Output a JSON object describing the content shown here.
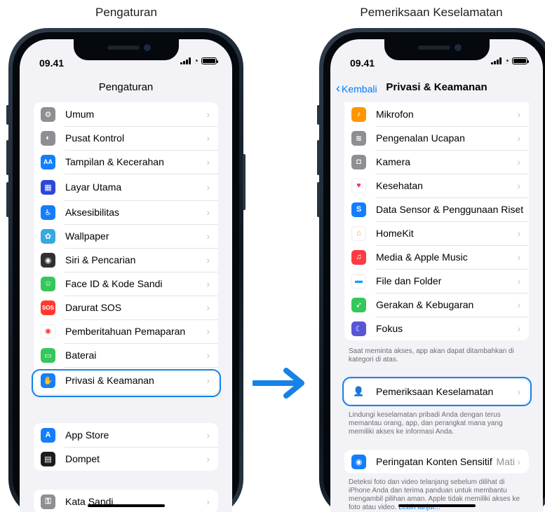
{
  "captions": {
    "left": "Pengaturan",
    "right": "Pemeriksaan Keselamatan"
  },
  "left_phone": {
    "time": "09.41",
    "nav_title": "Pengaturan",
    "group1": [
      {
        "label": "Umum",
        "icon": "gear-icon",
        "color": "#8e8e93"
      },
      {
        "label": "Pusat Kontrol",
        "icon": "toggle-icon",
        "color": "#8e8e93"
      },
      {
        "label": "Tampilan & Kecerahan",
        "icon": "text-size-icon",
        "color": "#147efb"
      },
      {
        "label": "Layar Utama",
        "icon": "home-grid-icon",
        "color": "#2c48d8"
      },
      {
        "label": "Aksesibilitas",
        "icon": "accessibility-icon",
        "color": "#147efb"
      },
      {
        "label": "Wallpaper",
        "icon": "flower-icon",
        "color": "#36a9e1"
      },
      {
        "label": "Siri & Pencarian",
        "icon": "siri-icon",
        "color": "#303030"
      },
      {
        "label": "Face ID & Kode Sandi",
        "icon": "face-id-icon",
        "color": "#34c759"
      },
      {
        "label": "Darurat SOS",
        "icon": "sos-icon",
        "color": "#ff3b30"
      },
      {
        "label": "Pemberitahuan Pemaparan",
        "icon": "exposure-icon",
        "color": "#ffffff"
      },
      {
        "label": "Baterai",
        "icon": "battery-icon",
        "color": "#34c759"
      },
      {
        "label": "Privasi & Keamanan",
        "icon": "hand-icon",
        "color": "#147efb"
      }
    ],
    "group2": [
      {
        "label": "App Store",
        "icon": "app-store-icon",
        "color": "#147efb"
      },
      {
        "label": "Dompet",
        "icon": "wallet-icon",
        "color": "#1c1c1e"
      }
    ],
    "group3": [
      {
        "label": "Kata Sandi",
        "icon": "key-icon",
        "color": "#8e8e93"
      }
    ]
  },
  "right_phone": {
    "time": "09.41",
    "back_label": "Kembali",
    "nav_title": "Privasi & Keamanan",
    "group1": [
      {
        "label": "Mikrofon",
        "icon": "microphone-icon",
        "color": "#ff9500"
      },
      {
        "label": "Pengenalan Ucapan",
        "icon": "waveform-icon",
        "color": "#8e8e93"
      },
      {
        "label": "Kamera",
        "icon": "camera-icon",
        "color": "#8e8e93"
      },
      {
        "label": "Kesehatan",
        "icon": "heart-icon",
        "color": "#ffffff"
      },
      {
        "label": "Data Sensor & Penggunaan Riset",
        "icon": "research-icon",
        "color": "#147efb"
      },
      {
        "label": "HomeKit",
        "icon": "home-icon",
        "color": "#ffffff"
      },
      {
        "label": "Media & Apple Music",
        "icon": "music-icon",
        "color": "#fc3c44"
      },
      {
        "label": "File dan Folder",
        "icon": "folder-icon",
        "color": "#ffffff"
      },
      {
        "label": "Gerakan & Kebugaran",
        "icon": "fitness-icon",
        "color": "#34c759"
      },
      {
        "label": "Fokus",
        "icon": "moon-icon",
        "color": "#5856d6"
      }
    ],
    "note1": "Saat meminta akses, app akan dapat ditambahkan di kategori di atas.",
    "safety_check_label": "Pemeriksaan Keselamatan",
    "note2": "Lindungi keselamatan pribadi Anda dengan terus memantau orang, app, dan perangkat mana yang memiliki akses ke informasi Anda.",
    "sensitive_label": "Peringatan Konten Sensitif",
    "sensitive_value": "Mati",
    "note3": "Deteksi foto dan video telanjang sebelum dilihat di iPhone Anda dan terima panduan untuk membantu mengambil pilihan aman. Apple tidak memiliki akses ke foto atau video.",
    "note3_link": "Lebih lanjut..."
  },
  "accent": "#1582e8"
}
